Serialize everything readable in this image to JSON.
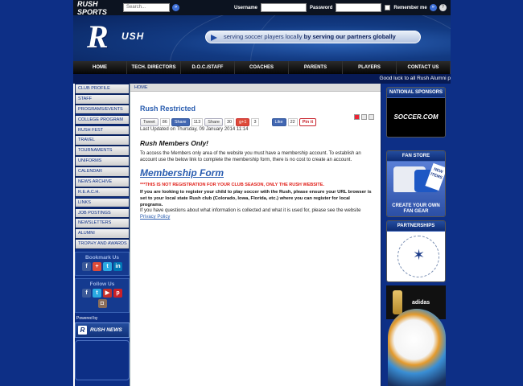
{
  "topbar": {
    "brand": "RUSH SPORTS",
    "search_placeholder": "Search...",
    "username_label": "Username",
    "password_label": "Password",
    "remember_label": "Remember me",
    "go_glyph": "»",
    "login_glyph": "»",
    "help_glyph": "?"
  },
  "banner": {
    "logo_letter": "R",
    "logo_rest": "USH",
    "tagline_plain": "serving soccer players locally ",
    "tagline_bold": "by serving our partners globally"
  },
  "nav": [
    "HOME",
    "TECH. DIRECTORS",
    "D.O.C./STAFF",
    "COACHES",
    "PARENTS",
    "PLAYERS",
    "CONTACT US"
  ],
  "ticker": "Good luck to all Rush Alumni p",
  "sidebar": {
    "menu": [
      "CLUB PROFILE",
      "STAFF",
      "PROGRAMS/EVENTS",
      "COLLEGE PROGRAM",
      "RUSH FEST",
      "TRAVEL",
      "TOURNAMENTS",
      "UNIFORMS",
      "CALENDAR",
      "NEWS ARCHIVE",
      "R.E.A.C.H.",
      "LINKS",
      "JOB POSTINGS",
      "NEWSLETTERS",
      "ALUMNI",
      "TROPHY AND AWARDS"
    ],
    "bookmark_title": "Bookmark Us",
    "follow_title": "Follow Us",
    "powered_by": "Powered by",
    "rush_news": "RUSH NEWS"
  },
  "content": {
    "breadcrumb": "HOME",
    "title": "Rush Restricted",
    "share": {
      "tweet": "Tweet",
      "tweet_count": "86",
      "fb_share": "Share",
      "fb_count": "113",
      "li_share": "Share",
      "li_count": "30",
      "gplus": "g+1",
      "gplus_count": "3",
      "like": "Like",
      "like_count": "22",
      "pin": "Pin it"
    },
    "updated": "Last Updated on Thursday, 09 January 2014 11:14",
    "members_only": "Rush Members Only!",
    "intro": "To access the Members only area of the website you must have a membership account. To establish an account use the below link to complete the membership form, there is no cost to create an account.",
    "form_link": "Membership Form",
    "warning": "***THIS IS NOT REGISTRATION FOR YOUR CLUB SEASON, ONLY THE RUSH WEBSITE.",
    "register_note": "If you are looking to register your child to play soccer with the Rush, please ensure your URL browser is set to your local state Rush club (Colorado, Iowa, Florida, etc.) where you can register for local programs.",
    "privacy_text": "If you have questions about what information is collected and what it is used for, please see the website ",
    "privacy_link": "Privacy Policy"
  },
  "right": {
    "sponsors_title": "NATIONAL SPONSORS",
    "sponsor_name": "SOCCER.COM",
    "fanstore_title": "FAN STORE",
    "fanstore_ribbon": "NEW ITEMS",
    "fanstore_cta": "CREATE YOUR OWN FAN GEAR",
    "partnerships_title": "PARTNERSHIPS",
    "adidas": "adidas"
  }
}
